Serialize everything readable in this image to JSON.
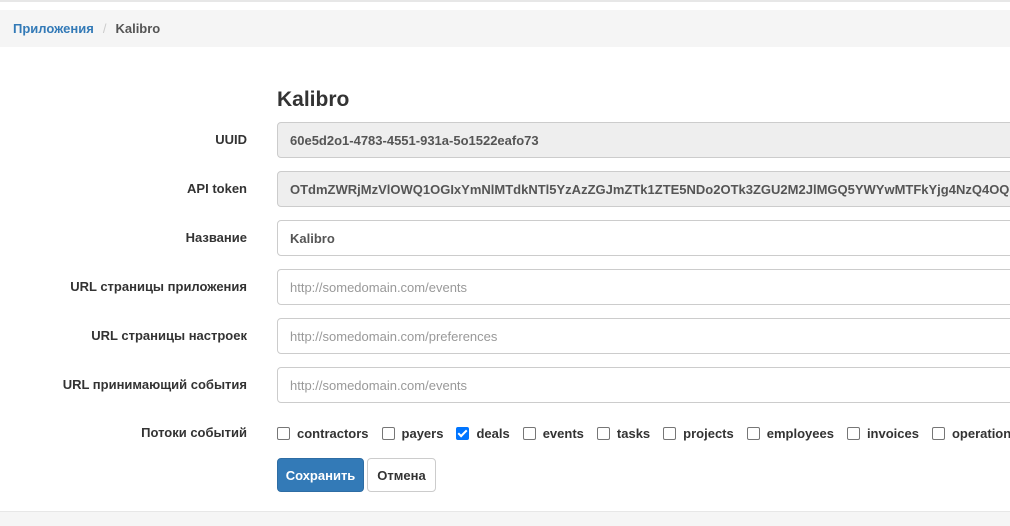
{
  "breadcrumb": {
    "parent": "Приложения",
    "separator": "/",
    "current": "Kalibro"
  },
  "form": {
    "title": "Kalibro",
    "uuid": {
      "label": "UUID",
      "value": "60e5d2o1-4783-4551-931a-5o1522eafo73"
    },
    "api_token": {
      "label": "API token",
      "value": "OTdmZWRjMzVlOWQ1OGIxYmNlMTdkNTl5YzAzZGJmZTk1ZTE5NDo2OTk3ZGU2M2JlMGQ5YWYwMTFkYjg4NzQ4OQ"
    },
    "name": {
      "label": "Название",
      "value": "Kalibro"
    },
    "app_url": {
      "label": "URL страницы приложения",
      "value": "",
      "placeholder": "http://somedomain.com/events"
    },
    "settings_url": {
      "label": "URL страницы настроек",
      "value": "",
      "placeholder": "http://somedomain.com/preferences"
    },
    "events_url": {
      "label": "URL принимающий события",
      "value": "",
      "placeholder": "http://somedomain.com/events"
    },
    "streams": {
      "label": "Потоки событий",
      "items": [
        {
          "label": "contractors",
          "checked": false
        },
        {
          "label": "payers",
          "checked": false
        },
        {
          "label": "deals",
          "checked": true
        },
        {
          "label": "events",
          "checked": false
        },
        {
          "label": "tasks",
          "checked": false
        },
        {
          "label": "projects",
          "checked": false
        },
        {
          "label": "employees",
          "checked": false
        },
        {
          "label": "invoices",
          "checked": false
        },
        {
          "label": "operations",
          "checked": false
        }
      ]
    },
    "save_label": "Сохранить",
    "cancel_label": "Отмена"
  },
  "colors": {
    "link": "#337ab7",
    "primary": "#337ab7",
    "checkbox_checked": "#0075ff",
    "readonly_bg": "#eeeeee"
  }
}
